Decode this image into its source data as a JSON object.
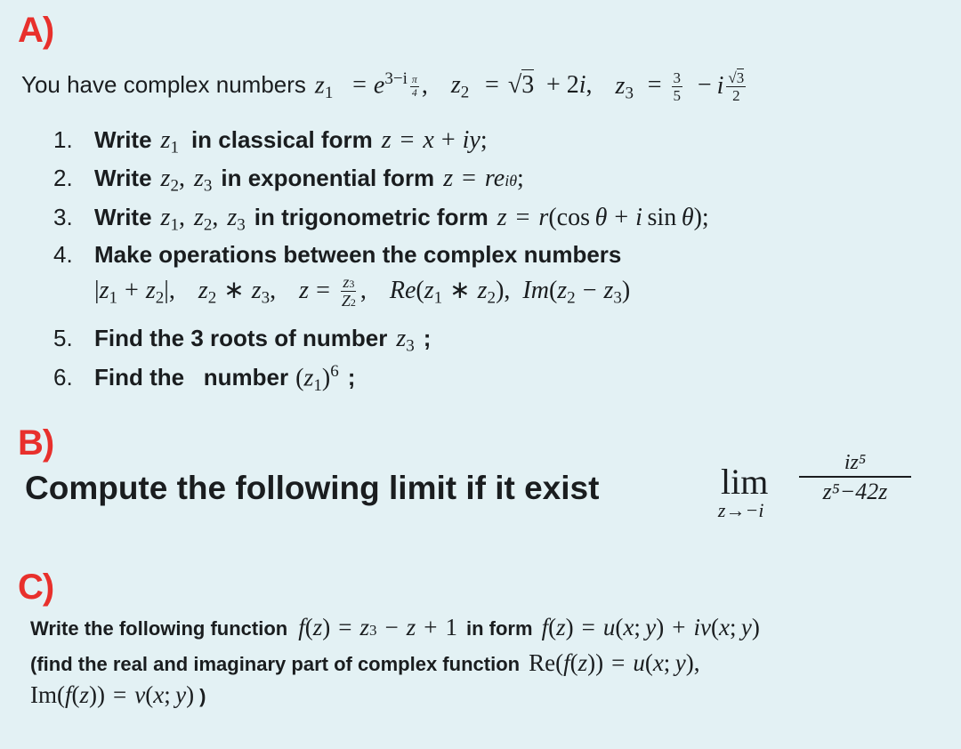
{
  "sections": {
    "a": {
      "label": "A)",
      "intro": "You have complex numbers",
      "z1": {
        "name": "z",
        "sub": "1",
        "eq": "=",
        "base": "e",
        "exp": "3−i",
        "exp_frac_num": "π",
        "exp_frac_den": "4",
        "sep": ","
      },
      "z2": {
        "name": "z",
        "sub": "2",
        "eq": "=",
        "rad": "3",
        "rest": "+ 2",
        "i": "i",
        "sep": ","
      },
      "z3": {
        "name": "z",
        "sub": "3",
        "eq": "=",
        "frac_num": "3",
        "frac_den": "5",
        "minus": "−",
        "i": "i",
        "frac2_num_rad": "3",
        "frac2_den": "2"
      },
      "tasks": [
        {
          "num": "1.",
          "pre": "Write",
          "vars": [
            "z₁"
          ],
          "text": "in classical form",
          "formula": "z = x + iy;"
        },
        {
          "num": "2.",
          "pre": "Write",
          "vars": [
            "z₂",
            "z₃"
          ],
          "text": "in exponential form",
          "formula": "z = re^{iθ};"
        },
        {
          "num": "3.",
          "pre": "Write",
          "vars": [
            "z₁",
            "z₂",
            "z₃"
          ],
          "text": "in trigonometric form",
          "formula": "z = r(cos θ + i sin θ);"
        },
        {
          "num": "4.",
          "text": "Make operations between the complex numbers",
          "operations": [
            "|z₁ + z₂|",
            "z₂ ∗ z₃",
            "z = z₃ / Z₂",
            "Re(z₁ ∗ z₂)",
            "Im(z₂ − z₃)"
          ]
        },
        {
          "num": "5.",
          "text": "Find the 3 roots of number",
          "formula": "z₃ ;"
        },
        {
          "num": "6.",
          "text": "Find the   number",
          "formula": "(z₁)⁶ ;"
        }
      ]
    },
    "b": {
      "label": "B)",
      "text": "Compute the following limit if it exist",
      "lim": "lim",
      "lim_under": "z→−i",
      "numerator": "iz⁵",
      "denominator": "z⁵−42z"
    },
    "c": {
      "label": "C)",
      "line1_text": "Write the following function",
      "line1_formula": "f(z) = z³ − z + 1",
      "line1_mid": "in form",
      "line1_formula2": "f(z) = u(x; y) + iv(x; y)",
      "line2_text": "(find the real and imaginary part of complex function",
      "line2_formula": "Re(f(z)) = u(x; y),",
      "line3_formula": "Im(f(z)) = v(x; y)",
      "line3_close": ")"
    }
  },
  "colors": {
    "label": "#e8302c",
    "background": "#e3f1f4",
    "text": "#1a1d1f"
  }
}
